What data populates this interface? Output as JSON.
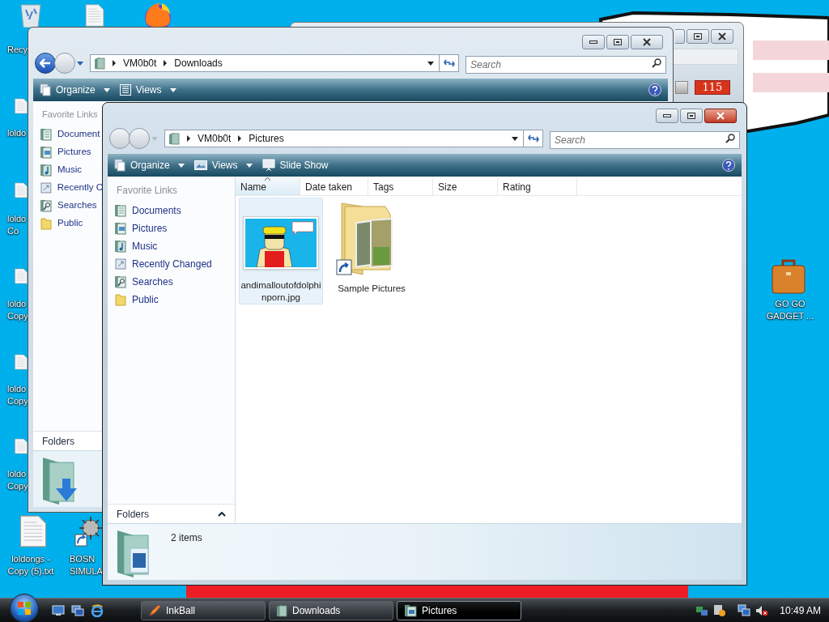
{
  "desktop": {
    "icons": [
      {
        "kind": "recycle_bin",
        "lines": [
          "Recy"
        ]
      },
      {
        "kind": "document"
      },
      {
        "kind": "browser"
      },
      {
        "kind": "document",
        "lines": [
          "loldo"
        ]
      },
      {
        "kind": "document",
        "lines": [
          "loldo",
          "Co"
        ]
      },
      {
        "kind": "document",
        "lines": [
          "loldo",
          "Copy"
        ]
      },
      {
        "kind": "document",
        "lines": [
          "loldo",
          "Copy"
        ]
      },
      {
        "kind": "document",
        "lines": [
          "loldo",
          "Copy"
        ]
      },
      {
        "kind": "document",
        "lines": [
          "loldongs -",
          "Copy (5).txt"
        ]
      },
      {
        "kind": "shortcut",
        "lines": [
          "BOSN",
          "SIMULA"
        ]
      },
      {
        "kind": "briefcase",
        "lines": [
          "GO GO",
          "GADGET ..."
        ]
      }
    ]
  },
  "inkball_window": {
    "score": "115"
  },
  "downloads_window": {
    "back_enabled": true,
    "breadcrumb": [
      "VM0b0t",
      "Downloads"
    ],
    "search": {
      "placeholder": "Search"
    },
    "toolbar": [
      {
        "label": "Organize",
        "kind": "organize"
      },
      {
        "label": "Views",
        "kind": "views_list"
      }
    ],
    "favorite_links": {
      "heading": "Favorite Links",
      "items": [
        {
          "label": "Document",
          "kind": "documents"
        },
        {
          "label": "Pictures",
          "kind": "pictures"
        },
        {
          "label": "Music",
          "kind": "music"
        },
        {
          "label": "Recently C",
          "kind": "recent"
        },
        {
          "label": "Searches",
          "kind": "searches"
        },
        {
          "label": "Public",
          "kind": "public"
        }
      ]
    },
    "folders_label": "Folders"
  },
  "pictures_window": {
    "back_enabled": false,
    "breadcrumb": [
      "VM0b0t",
      "Pictures"
    ],
    "search": {
      "placeholder": "Search"
    },
    "toolbar": [
      {
        "label": "Organize",
        "kind": "organize"
      },
      {
        "label": "Views",
        "kind": "views_picture"
      },
      {
        "label": "Slide Show",
        "kind": "slideshow"
      }
    ],
    "favorite_links": {
      "heading": "Favorite Links",
      "items": [
        {
          "label": "Documents",
          "kind": "documents"
        },
        {
          "label": "Pictures",
          "kind": "pictures"
        },
        {
          "label": "Music",
          "kind": "music"
        },
        {
          "label": "Recently Changed",
          "kind": "recent"
        },
        {
          "label": "Searches",
          "kind": "searches"
        },
        {
          "label": "Public",
          "kind": "public"
        }
      ]
    },
    "folders_label": "Folders",
    "columns": [
      {
        "label": "Name",
        "sorted": true
      },
      {
        "label": "Date taken",
        "sorted": false
      },
      {
        "label": "Tags",
        "sorted": false
      },
      {
        "label": "Size",
        "sorted": false
      },
      {
        "label": "Rating",
        "sorted": false
      }
    ],
    "items": [
      {
        "name": "andimalloutofdolphinporn.jpg",
        "selected": true
      },
      {
        "kind": "folder",
        "name": "Sample Pictures",
        "selected": false
      }
    ],
    "status": "2 items"
  },
  "taskbar": {
    "buttons": [
      {
        "label": "InkBall",
        "kind": "game",
        "selected": false
      },
      {
        "label": "Downloads",
        "kind": "folder",
        "selected": false
      },
      {
        "label": "Pictures",
        "kind": "pictures",
        "selected": true
      }
    ],
    "clock": "10:49 AM"
  }
}
